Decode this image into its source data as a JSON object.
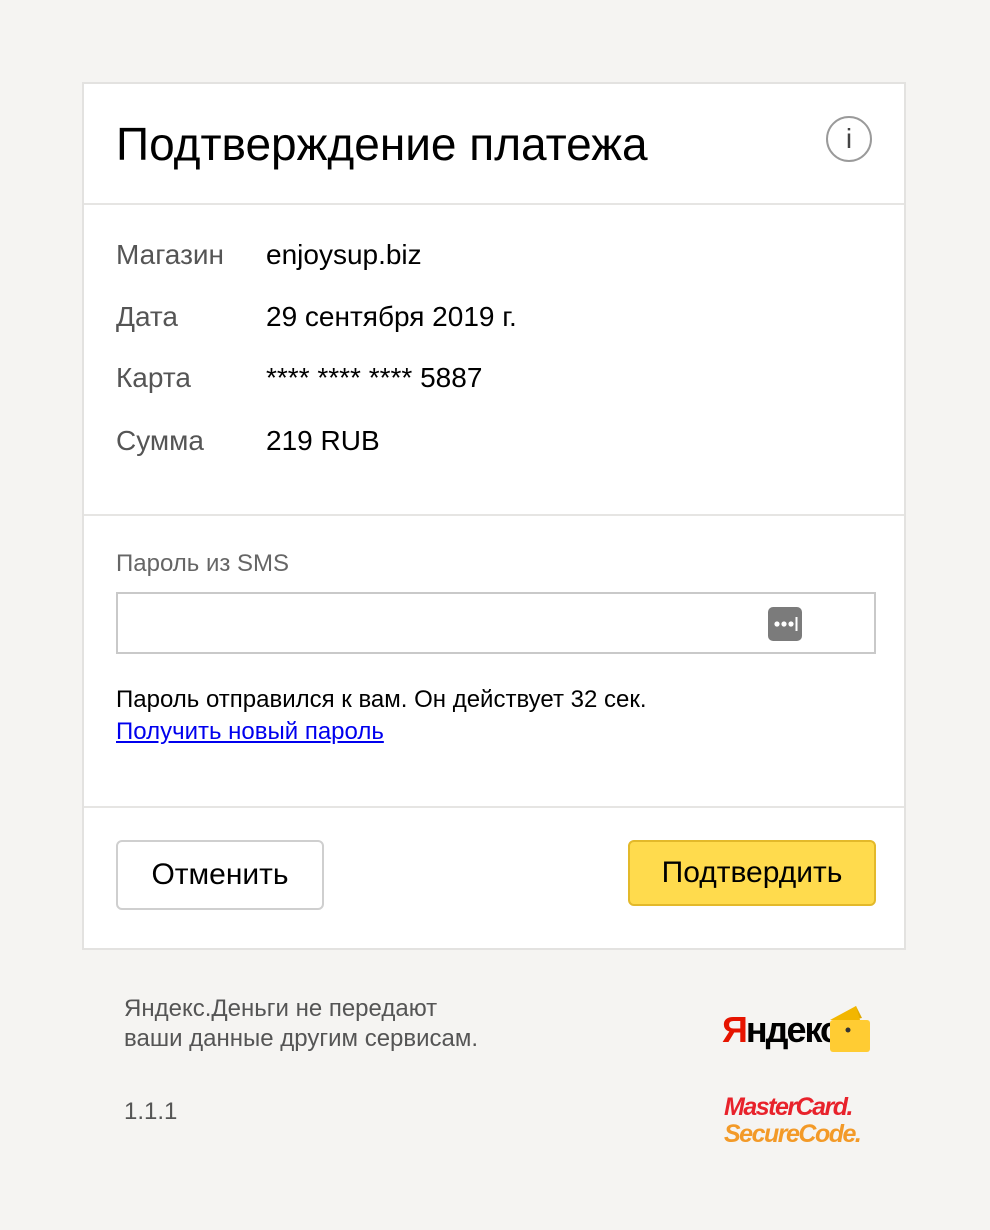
{
  "card": {
    "title": "Подтверждение платежа",
    "info_glyph": "i",
    "details": [
      {
        "label": "Магазин",
        "value": "enjoysup.biz"
      },
      {
        "label": "Дата",
        "value": "29 сентября 2019 г."
      },
      {
        "label": "Карта",
        "value": "**** **** **** 5887"
      },
      {
        "label": "Сумма",
        "value": "219 RUB"
      }
    ],
    "sms": {
      "label": "Пароль из SMS",
      "value": "",
      "placeholder": "",
      "note": "Пароль отправился к вам. Он действует 32 сек.",
      "resend_link": "Получить новый пароль"
    },
    "actions": {
      "cancel_label": "Отменить",
      "confirm_label": "Подтвердить"
    }
  },
  "footer": {
    "note_line1": "Яндекс.Деньги не передают",
    "note_line2": "ваши данные другим сервисам.",
    "version": "1.1.1",
    "yandex_logo_first": "Я",
    "yandex_logo_rest": "ндекс",
    "mastercard_line1": "MasterCard.",
    "mastercard_line2": "SecureCode."
  },
  "icons": {
    "info": "info-icon",
    "password_manager": "password-dots-icon",
    "wallet": "wallet-icon"
  },
  "colors": {
    "page_bg": "#f5f4f2",
    "card_bg": "#ffffff",
    "confirm_button": "#ffdb4d",
    "link": "#0000ee",
    "yandex_red": "#e61400",
    "wallet_yellow": "#ffcc33",
    "mastercard_red": "#e8222b",
    "mastercard_orange": "#f39a28"
  }
}
